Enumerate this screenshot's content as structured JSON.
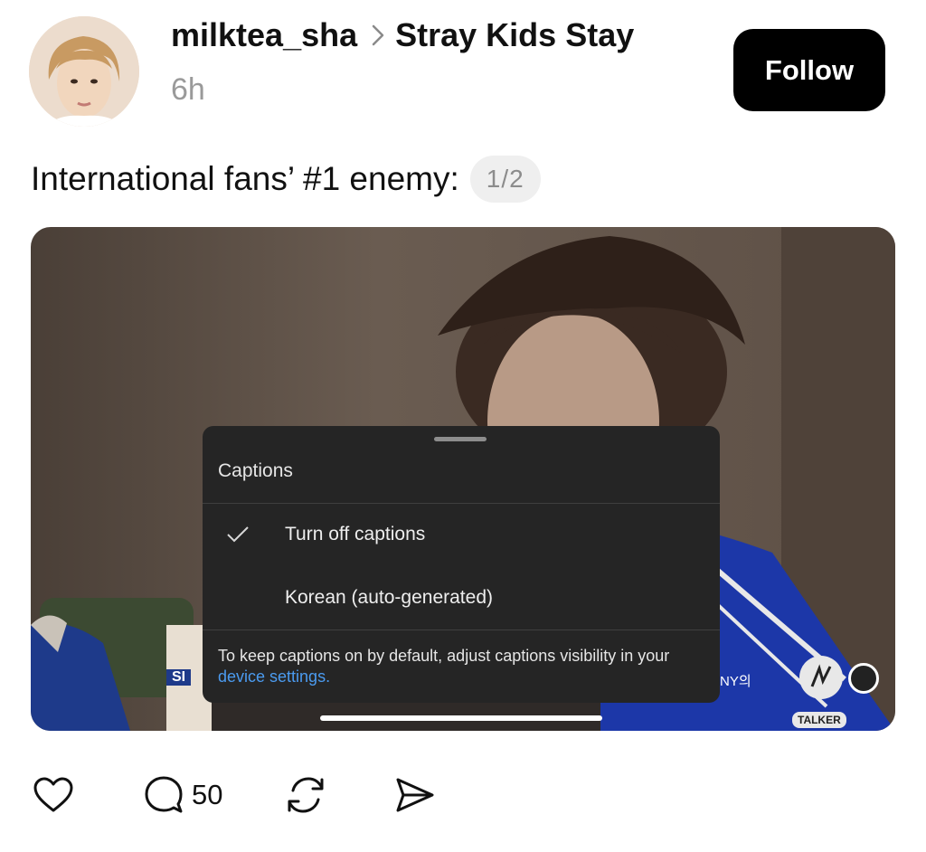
{
  "post": {
    "username": "milktea_sha",
    "group": "Stray Kids Stay",
    "time": "6h",
    "follow_label": "Follow",
    "text": "International fans’ #1 enemy:",
    "pager": "1/2"
  },
  "captions_sheet": {
    "title": "Captions",
    "options": [
      {
        "label": "Turn off captions",
        "selected": true
      },
      {
        "label": "Korean (auto-generated)",
        "selected": false
      }
    ],
    "note_text": "To keep captions on by default, adjust captions visibility in your",
    "note_link": "device settings."
  },
  "video_overlay": {
    "left_tag": "SI",
    "right_text": "NY의",
    "logo_text": "TALKER",
    "progress": 1.0
  },
  "actions": {
    "comment_count": "50"
  },
  "colors": {
    "follow_bg": "#000000",
    "link": "#4b9bf0",
    "sheet_bg": "#252525"
  }
}
